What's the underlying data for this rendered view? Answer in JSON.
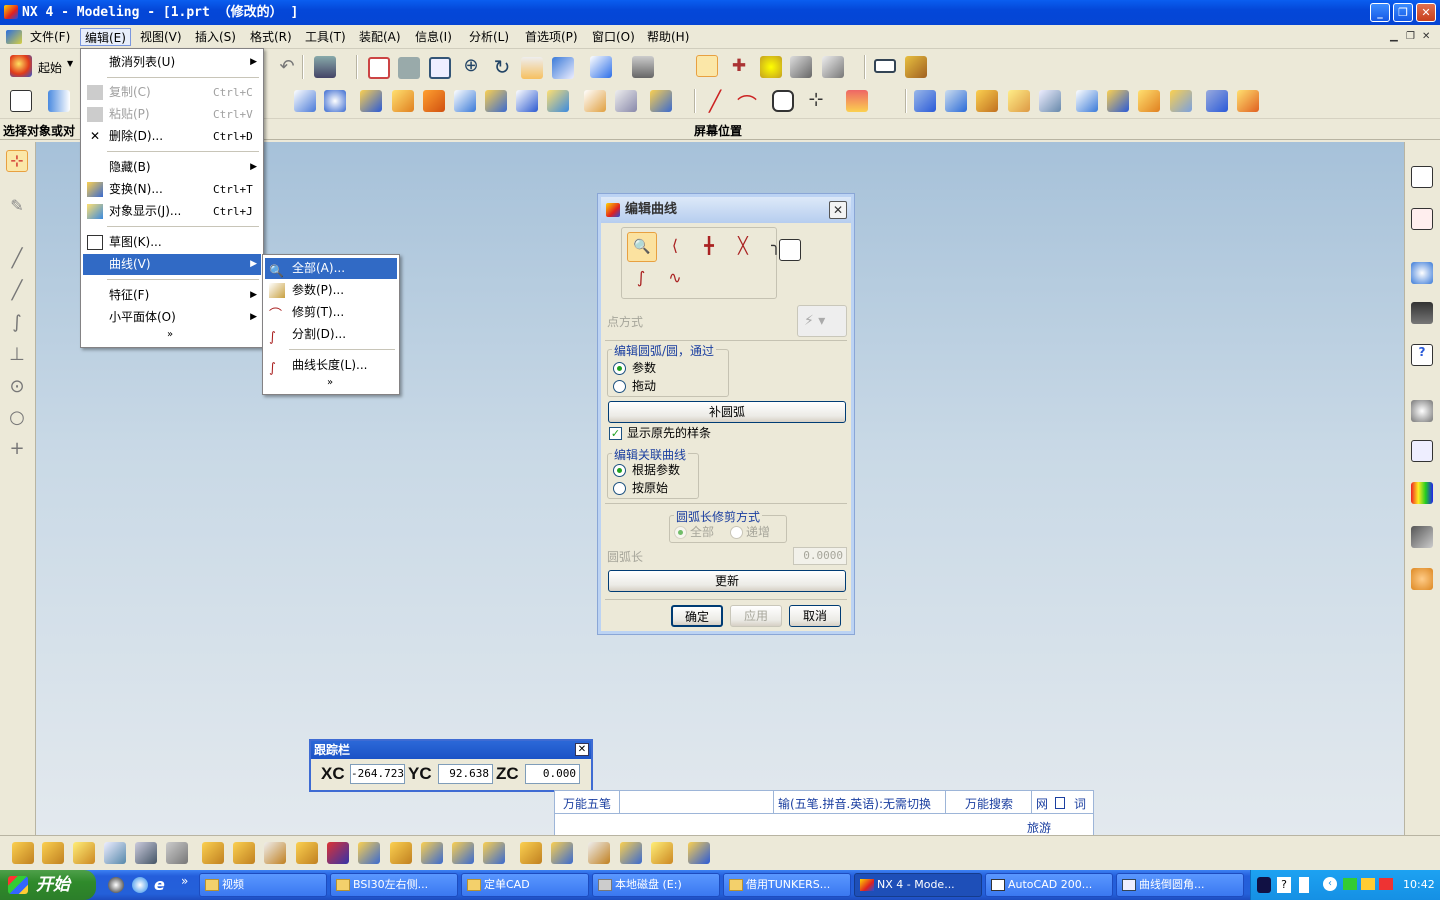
{
  "window": {
    "title": "NX 4 - Modeling - [1.prt （修改的） ]",
    "btn_min": "_",
    "btn_max": "❐",
    "btn_close": "✕"
  },
  "menubar": [
    {
      "label": "文件(F)"
    },
    {
      "label": "编辑(E)"
    },
    {
      "label": "视图(V)"
    },
    {
      "label": "插入(S)"
    },
    {
      "label": "格式(R)"
    },
    {
      "label": "工具(T)"
    },
    {
      "label": "装配(A)"
    },
    {
      "label": "信息(I)"
    },
    {
      "label": "分析(L)"
    },
    {
      "label": "首选项(P)"
    },
    {
      "label": "窗口(O)"
    },
    {
      "label": "帮助(H)"
    }
  ],
  "toolbar": {
    "start_label": "起始"
  },
  "selection_bar": {
    "label": "选择对象或对",
    "screen_position": "屏幕位置"
  },
  "edit_menu": {
    "items": [
      {
        "label": "撤消列表(U)"
      },
      {
        "label": "复制(C)",
        "accel": "Ctrl+C"
      },
      {
        "label": "粘贴(P)",
        "accel": "Ctrl+V"
      },
      {
        "label": "删除(D)...",
        "accel": "Ctrl+D"
      },
      {
        "label": "隐藏(B)"
      },
      {
        "label": "变换(N)...",
        "accel": "Ctrl+T"
      },
      {
        "label": "对象显示(J)...",
        "accel": "Ctrl+J"
      },
      {
        "label": "草图(K)..."
      },
      {
        "label": "曲线(V)"
      },
      {
        "label": "特征(F)"
      },
      {
        "label": "小平面体(O)"
      }
    ],
    "expand": "»"
  },
  "curve_submenu": {
    "items": [
      {
        "label": "全部(A)..."
      },
      {
        "label": "参数(P)..."
      },
      {
        "label": "修剪(T)..."
      },
      {
        "label": "分割(D)..."
      },
      {
        "label": "曲线长度(L)..."
      }
    ],
    "expand": "»"
  },
  "dialog": {
    "title": "编辑曲线",
    "point_method_label": "点方式",
    "group1_title": "编辑圆弧/圆，通过",
    "radio_param": "参数",
    "radio_drag": "拖动",
    "complement_button": "补圆弧",
    "show_original_spline": "显示原先的样条",
    "group2_title": "编辑关联曲线",
    "radio_by_param": "根据参数",
    "radio_as_original": "按原始",
    "group3_title": "圆弧长修剪方式",
    "radio_all": "全部",
    "radio_incremental": "递增",
    "arc_length_label": "圆弧长",
    "arc_length_value": "0.0000",
    "update_button": "更新",
    "ok_button": "确定",
    "apply_button": "应用",
    "cancel_button": "取消"
  },
  "tracking": {
    "title": "跟踪栏",
    "xc_label": "XC",
    "xc_value": "-264.723",
    "yc_label": "YC",
    "yc_value": "92.638",
    "zc_label": "ZC",
    "zc_value": "0.000"
  },
  "ime": {
    "name": "万能五笔",
    "mode": "输(五笔.拼音.英语):无需切换",
    "search": "万能搜索",
    "net": "网",
    "word": "词",
    "travel": "旅游"
  },
  "taskbar": {
    "start_label": "开始",
    "tasks": [
      {
        "label": "视频"
      },
      {
        "label": "BSI30左右侧..."
      },
      {
        "label": "定单CAD"
      },
      {
        "label": "本地磁盘 (E:)"
      },
      {
        "label": "借用TUNKERS..."
      },
      {
        "label": "NX 4 - Mode..."
      },
      {
        "label": "AutoCAD 200..."
      },
      {
        "label": "曲线倒圆角..."
      }
    ],
    "clock": "10:42"
  },
  "colors": {
    "title_blue": "#0a5ef0",
    "menu_highlight": "#316ac5",
    "canvas_top": "#a6c1d9",
    "canvas_bottom": "#e3e9ee",
    "dialog_bg": "#ece9d8",
    "group_title": "#1b3fa0"
  }
}
